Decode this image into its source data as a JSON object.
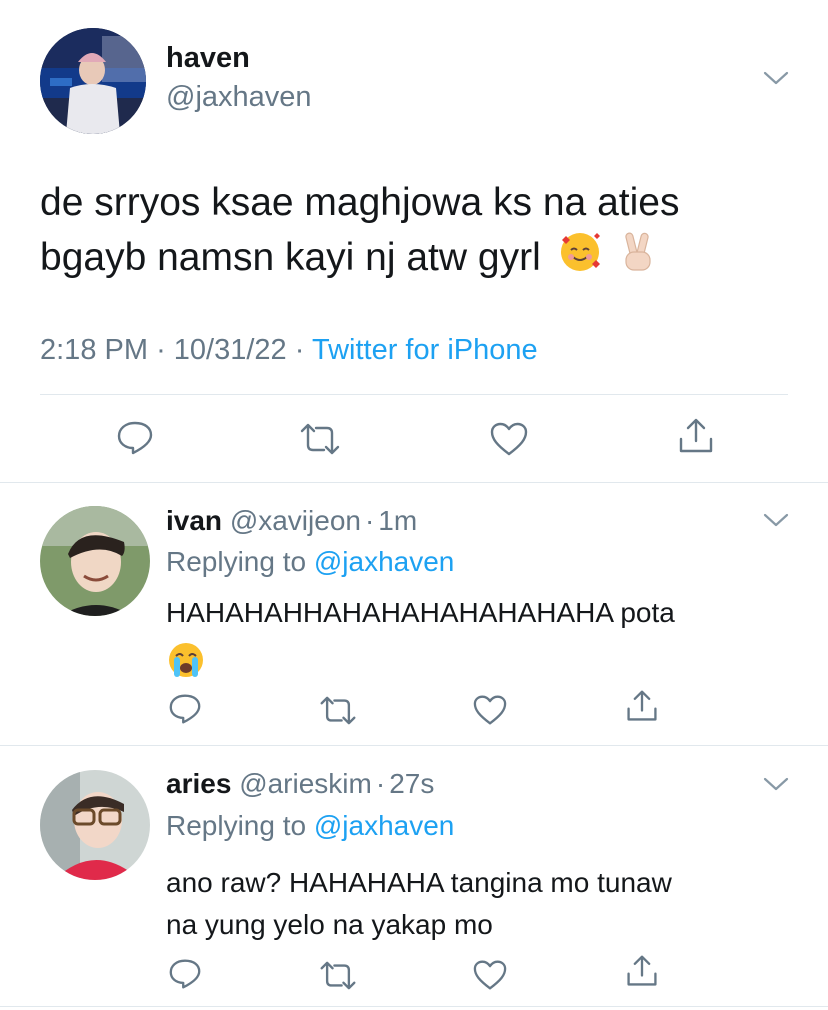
{
  "main_tweet": {
    "display_name": "haven",
    "handle": "@jaxhaven",
    "text_line1": "de srryos ksae maghjowa ks na aties",
    "text_line2": "bgayb namsn kayi nj atw gyrl",
    "emojis": [
      "smiling-face-with-hearts-icon",
      "victory-hand-icon"
    ],
    "time": "2:18 PM",
    "sep1": "·",
    "date": "10/31/22",
    "sep2": "·",
    "source": "Twitter for iPhone"
  },
  "replies": [
    {
      "display_name": "ivan",
      "handle": "@xavijeon",
      "sep": "·",
      "age": "1m",
      "replying_prefix": "Replying to",
      "replying_handle": "@jaxhaven",
      "text_line1": "HAHAHAHHAHAHAHAHAHAHAHA pota",
      "emoji": "loudly-crying-face-icon"
    },
    {
      "display_name": "aries",
      "handle": "@arieskim",
      "sep": "·",
      "age": "27s",
      "replying_prefix": "Replying to",
      "replying_handle": "@jaxhaven",
      "text_line1": "ano raw? HAHAHAHA tangina mo tunaw",
      "text_line2": "na yung yelo na yakap mo"
    }
  ],
  "colors": {
    "text": "#14171a",
    "secondary": "#657786",
    "link": "#1da1f2",
    "divider": "#e1e8ed"
  }
}
